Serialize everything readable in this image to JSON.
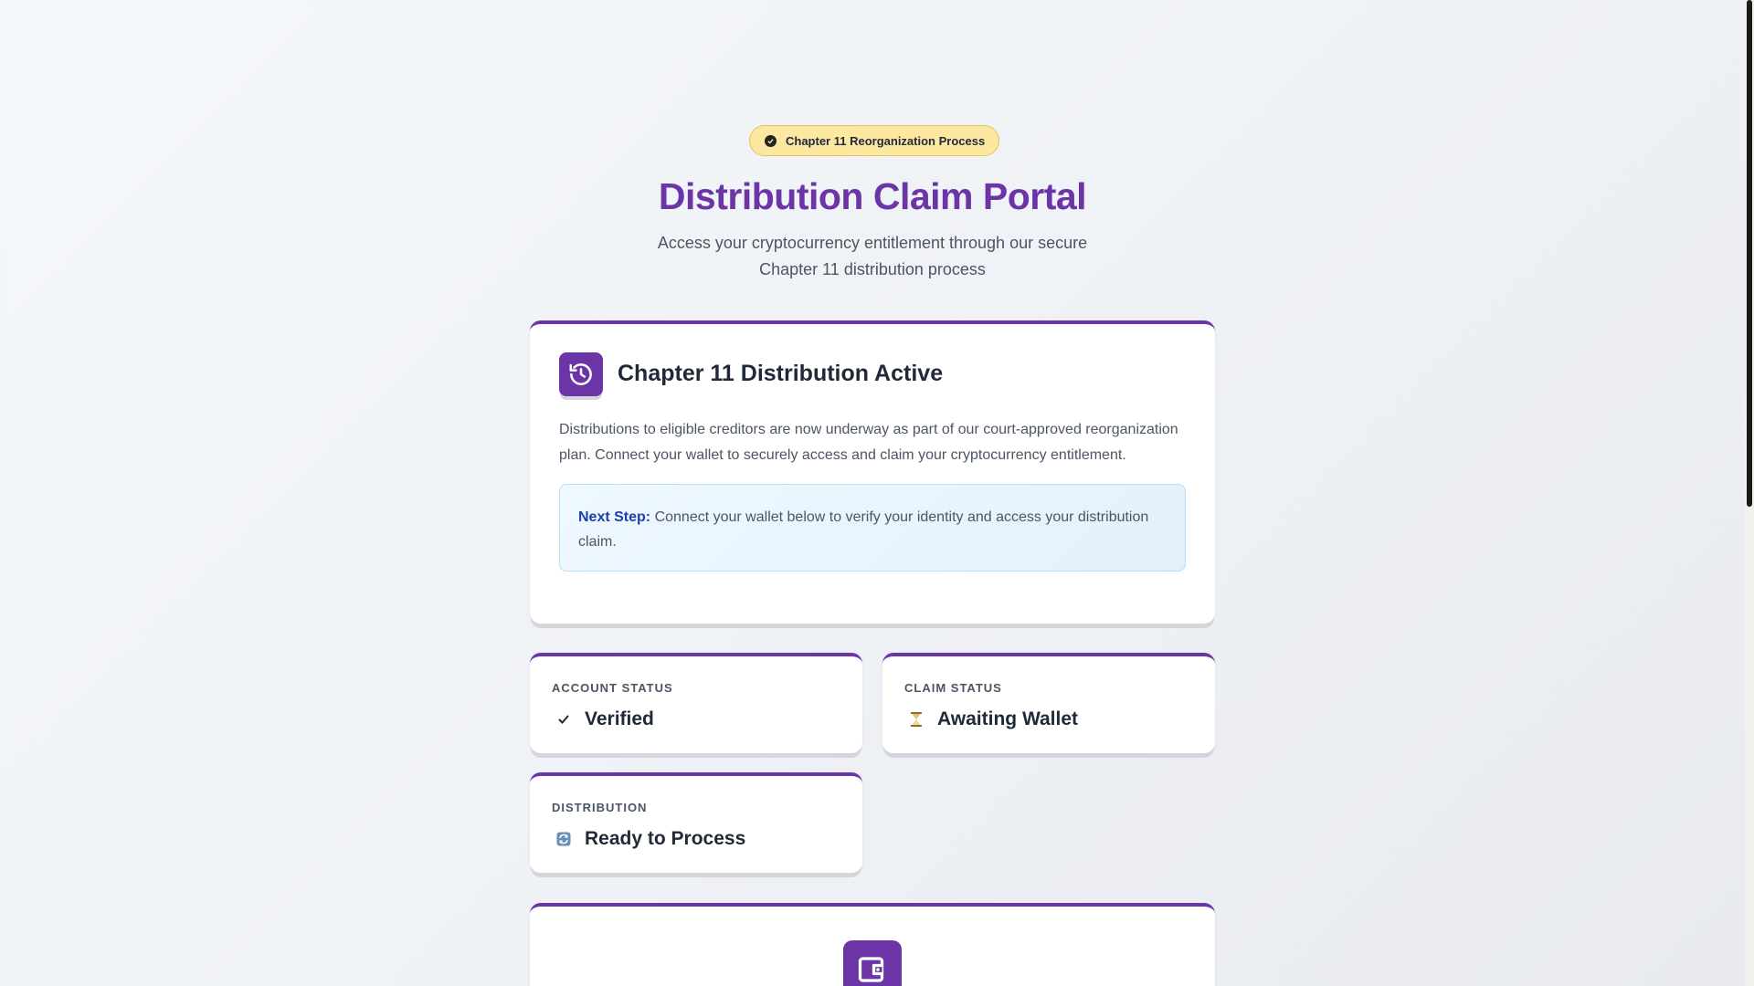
{
  "badge": {
    "icon": "shield-check-icon",
    "text": "Chapter 11 Reorganization Process"
  },
  "header": {
    "title": "Distribution Claim Portal",
    "subtitle": "Access your cryptocurrency entitlement through our secure Chapter 11 distribution process"
  },
  "main_card": {
    "icon": "history-icon",
    "title": "Chapter 11 Distribution Active",
    "body": "Distributions to eligible creditors are now underway as part of our court-approved reorganization plan. Connect your wallet to securely access and claim your cryptocurrency entitlement.",
    "next_step_label": "Next Step:",
    "next_step_text": " Connect your wallet below to verify your identity and access your distribution claim."
  },
  "status_cards": {
    "account": {
      "label": "ACCOUNT STATUS",
      "icon": "checkmark-icon",
      "value": "Verified"
    },
    "claim": {
      "label": "CLAIM STATUS",
      "icon": "hourglass-icon",
      "value": "Awaiting Wallet"
    },
    "distribution": {
      "label": "DISTRIBUTION",
      "icon": "refresh-icon",
      "value": "Ready to Process"
    }
  },
  "wallet_card": {
    "icon": "wallet-icon"
  },
  "colors": {
    "accent": "#6b35a8",
    "badge_bg": "#fde8a2",
    "info_label": "#1e40af"
  }
}
